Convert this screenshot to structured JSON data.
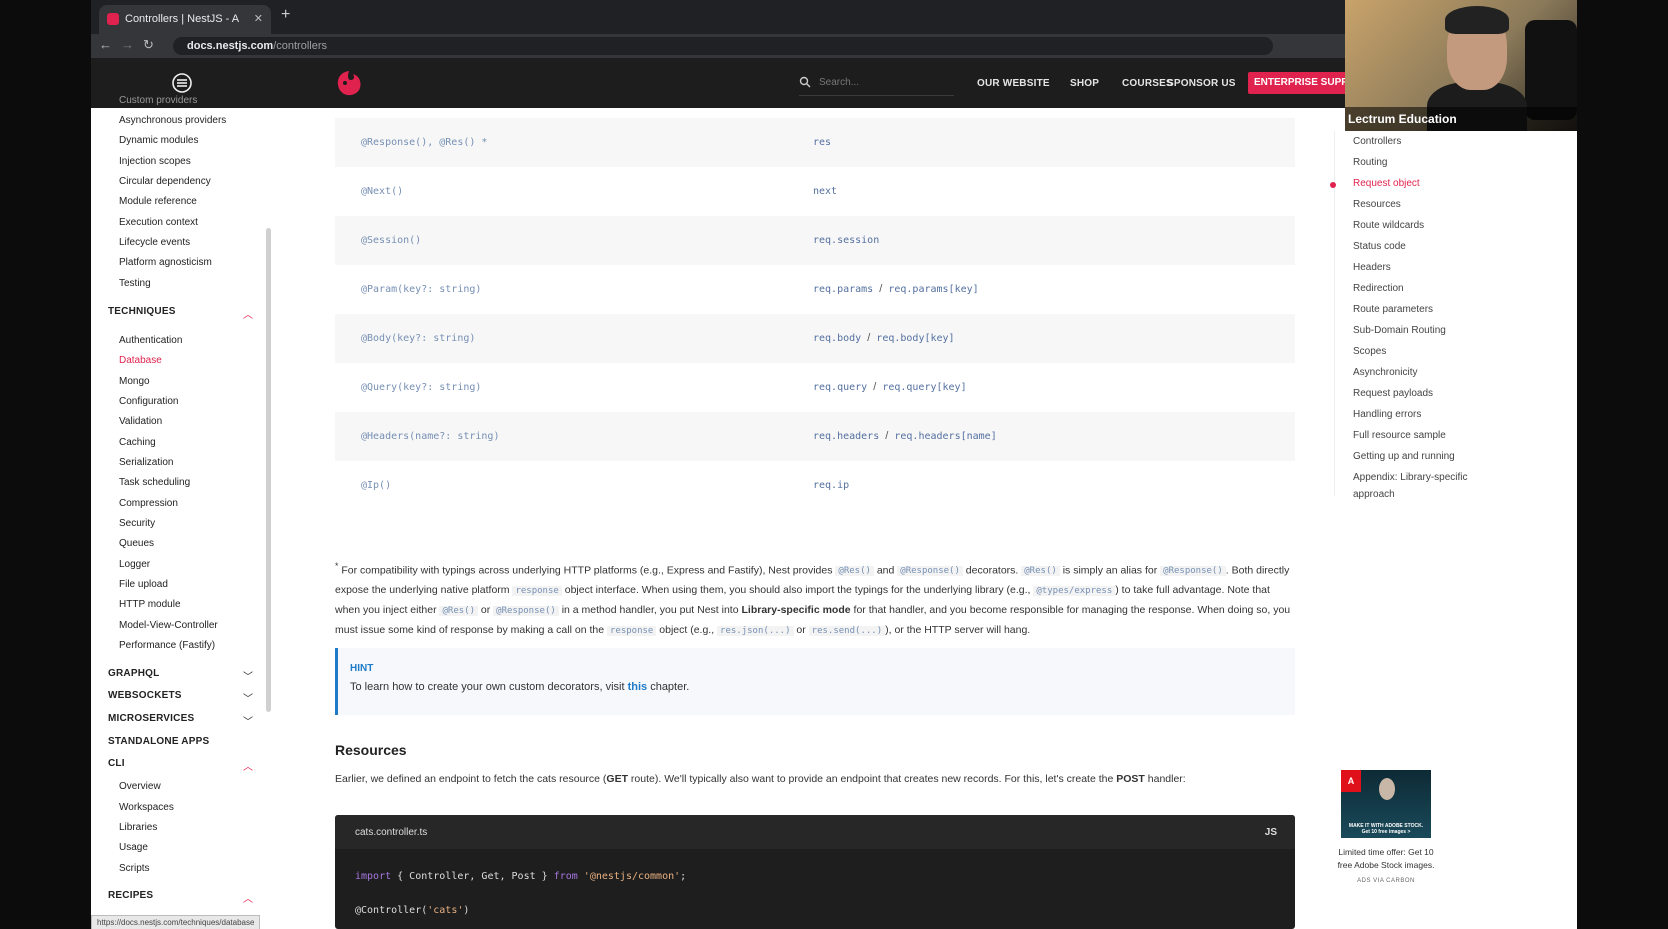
{
  "browser": {
    "tab_title": "Controllers | NestJS - A progre",
    "url_domain": "docs.nestjs.com",
    "url_path": "/controllers",
    "status_url": "https://docs.nestjs.com/techniques/database"
  },
  "header": {
    "search_placeholder": "Search...",
    "nav": [
      "OUR WEBSITE",
      "SHOP",
      "COURSES",
      "SPONSOR US"
    ],
    "enterprise": "ENTERPRISE SUPPOR"
  },
  "sidebar": {
    "top_items": [
      "Custom providers",
      "Asynchronous providers",
      "Dynamic modules",
      "Injection scopes",
      "Circular dependency",
      "Module reference",
      "Execution context",
      "Lifecycle events",
      "Platform agnosticism",
      "Testing"
    ],
    "techniques": {
      "title": "TECHNIQUES",
      "items": [
        "Authentication",
        "Database",
        "Mongo",
        "Configuration",
        "Validation",
        "Caching",
        "Serialization",
        "Task scheduling",
        "Compression",
        "Security",
        "Queues",
        "Logger",
        "File upload",
        "HTTP module",
        "Model-View-Controller",
        "Performance (Fastify)"
      ],
      "active": "Database"
    },
    "sections": [
      "GRAPHQL",
      "WEBSOCKETS",
      "MICROSERVICES",
      "STANDALONE APPS"
    ],
    "cli": {
      "title": "CLI",
      "items": [
        "Overview",
        "Workspaces",
        "Libraries",
        "Usage",
        "Scripts"
      ]
    },
    "recipes": "RECIPES"
  },
  "table": [
    {
      "decorator": "@Response(), @Res() *",
      "object": [
        "res"
      ]
    },
    {
      "decorator": "@Next()",
      "object": [
        "next"
      ]
    },
    {
      "decorator": "@Session()",
      "object": [
        "req.session"
      ]
    },
    {
      "decorator": "@Param(key?: string)",
      "object": [
        "req.params",
        "req.params[key]"
      ]
    },
    {
      "decorator": "@Body(key?: string)",
      "object": [
        "req.body",
        "req.body[key]"
      ]
    },
    {
      "decorator": "@Query(key?: string)",
      "object": [
        "req.query",
        "req.query[key]"
      ]
    },
    {
      "decorator": "@Headers(name?: string)",
      "object": [
        "req.headers",
        "req.headers[name]"
      ]
    },
    {
      "decorator": "@Ip()",
      "object": [
        "req.ip"
      ]
    }
  ],
  "table_separator": "/",
  "note": {
    "star": "*",
    "t1": " For compatibility with typings across underlying HTTP platforms (e.g., Express and Fastify), Nest provides ",
    "c1": "@Res()",
    "t2": " and ",
    "c2": "@Response()",
    "t3": " decorators. ",
    "c3": "@Res()",
    "t4": " is simply an alias for ",
    "c4": "@Response()",
    "t5": ". Both directly expose the underlying native platform ",
    "c5": "response",
    "t6": " object interface. When using them, you should also import the typings for the underlying library (e.g., ",
    "c6": "@types/express",
    "t7": ") to take full advantage. Note that when you inject either ",
    "c7": "@Res()",
    "t8": " or ",
    "c8": "@Response()",
    "t9": " in a method handler, you put Nest into ",
    "b1": "Library-specific mode",
    "t10": " for that handler, and you become responsible for managing the response. When doing so, you must issue some kind of response by making a call on the ",
    "c9": "response",
    "t11": " object (e.g., ",
    "c10": "res.json(...)",
    "t12": " or ",
    "c11": "res.send(...)",
    "t13": "), or the HTTP server will hang."
  },
  "hint": {
    "title": "HINT",
    "before": "To learn how to create your own custom decorators, visit ",
    "link": "this",
    "after": " chapter."
  },
  "resources": {
    "heading": "Resources",
    "t1": "Earlier, we defined an endpoint to fetch the cats resource (",
    "b1": "GET",
    "t2": " route). We'll typically also want to provide an endpoint that creates new records. For this, let's create the ",
    "b2": "POST",
    "t3": " handler:"
  },
  "code": {
    "filename": "cats.controller.ts",
    "lang": "JS",
    "l1_kw1": "import",
    "l1_mid": " { Controller, Get, Post } ",
    "l1_kw2": "from",
    "l1_str": " '@nestjs/common'",
    "l1_end": ";",
    "l2_dec": "@Controller(",
    "l2_str": "'cats'",
    "l2_end": ")"
  },
  "toc": {
    "items": [
      "Controllers",
      "Routing",
      "Request object",
      "Resources",
      "Route wildcards",
      "Status code",
      "Headers",
      "Redirection",
      "Route parameters",
      "Sub-Domain Routing",
      "Scopes",
      "Asynchronicity",
      "Request payloads",
      "Handling errors",
      "Full resource sample",
      "Getting up and running",
      "Appendix: Library-specific",
      "approach"
    ],
    "active": "Request object"
  },
  "ad": {
    "badge": "A",
    "tagline": "MAKE IT WITH ADOBE STOCK.",
    "tagline2": "Get 10 free images >",
    "text": "Limited time offer: Get 10 free Adobe Stock images.",
    "via": "ADS VIA CARBON"
  },
  "webcam": {
    "caption": "Lectrum Education"
  },
  "colors": {
    "accent": "#e0234e",
    "hint": "#1f7bc8",
    "header": "#1d1d1d"
  },
  "icons": [
    "hamburger-icon",
    "nestjs-logo-icon",
    "search-icon",
    "chevron-up-icon",
    "chevron-down-icon",
    "back-icon",
    "forward-icon",
    "reload-icon",
    "lock-icon",
    "close-icon",
    "plus-icon"
  ]
}
